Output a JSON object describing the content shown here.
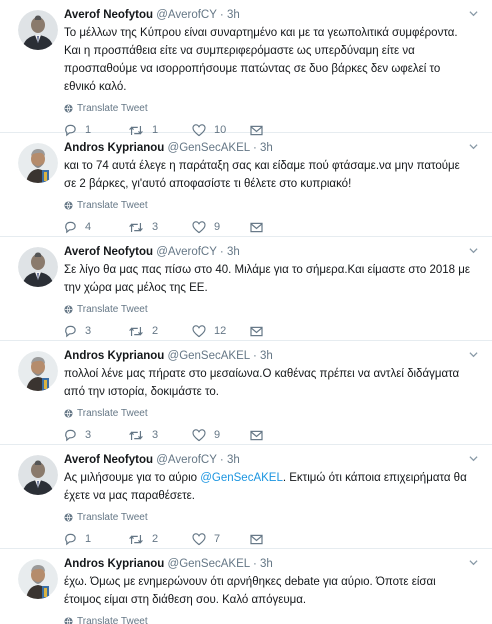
{
  "tweets": [
    {
      "name": "Averof Neofytou",
      "handle": "@AverofCY",
      "sep": "·",
      "time": "3h",
      "text_lines": [
        "Το μέλλων της Κύπρου είναι συναρτημένο και με τα γεωπολιτικά συμφέροντα.",
        "Και η προσπάθεια είτε να  συμπεριφερόμαστε ως υπερδύναμη είτε να",
        "προσπαθούμε να ισορροπήσουμε πατώντας σε δυο βάρκες δεν ωφελεί το",
        "εθνικό καλό."
      ],
      "mention": "",
      "mention_after": "",
      "translate": "Translate Tweet",
      "replies": "1",
      "retweets": "1",
      "likes": "10"
    },
    {
      "name": "Andros Kyprianou",
      "handle": "@GenSecAKEL",
      "sep": "·",
      "time": "3h",
      "text_lines": [
        "και το 74 αυτά έλεγε η παράταξη σας και είδαμε πού φτάσαμε.να μην πατούμε",
        "σε 2 βάρκες, γι'αυτό αποφασίστε τι θέλετε στο κυπριακό!"
      ],
      "mention": "",
      "mention_after": "",
      "translate": "Translate Tweet",
      "replies": "4",
      "retweets": "3",
      "likes": "9"
    },
    {
      "name": "Averof Neofytou",
      "handle": "@AverofCY",
      "sep": "·",
      "time": "3h",
      "text_lines": [
        "Σε λίγο θα μας πας πίσω στο 40. Μιλάμε για το σήμερα.Και είμαστε στο 2018 με",
        "την χώρα μας μέλος της ΕΕ."
      ],
      "mention": "",
      "mention_after": "",
      "translate": "Translate Tweet",
      "replies": "3",
      "retweets": "2",
      "likes": "12"
    },
    {
      "name": "Andros Kyprianou",
      "handle": "@GenSecAKEL",
      "sep": "·",
      "time": "3h",
      "text_lines": [
        "πολλοί λένε μας πήρατε στο μεσαίωνα.Ο καθένας πρέπει να αντλεί διδάγματα",
        "από την ιστορία, δοκιμάστε το."
      ],
      "mention": "",
      "mention_after": "",
      "translate": "Translate Tweet",
      "replies": "3",
      "retweets": "3",
      "likes": "9"
    },
    {
      "name": "Averof Neofytou",
      "handle": "@AverofCY",
      "sep": "·",
      "time": "3h",
      "text_lines": [
        "Ας μιλήσουμε για το αύριο ",
        "έχετε να μας παραθέσετε."
      ],
      "mention": "@GenSecAKEL",
      "mention_after": ". Εκτιμώ ότι κάποια επιχειρήματα θα",
      "translate": "Translate Tweet",
      "replies": "1",
      "retweets": "2",
      "likes": "7"
    },
    {
      "name": "Andros Kyprianou",
      "handle": "@GenSecAKEL",
      "sep": "·",
      "time": "3h",
      "text_lines": [
        "έχω. Όμως με ενημερώνουν ότι αρνήθηκες debate για αύριο. Όποτε είσαι",
        "έτοιμος είμαι στη διάθεση σου. Καλό απόγευμα."
      ],
      "mention": "",
      "mention_after": "",
      "translate": "Translate Tweet",
      "replies": "",
      "retweets": "",
      "likes": ""
    }
  ],
  "icons": {
    "reply": "reply-icon",
    "retweet": "retweet-icon",
    "like": "heart-icon",
    "dm": "envelope-icon",
    "translate": "globe-icon",
    "caret": "chevron-down-icon"
  },
  "colors": {
    "link": "#1b95e0",
    "secondary": "#657786",
    "divider": "#e6ecf0"
  }
}
